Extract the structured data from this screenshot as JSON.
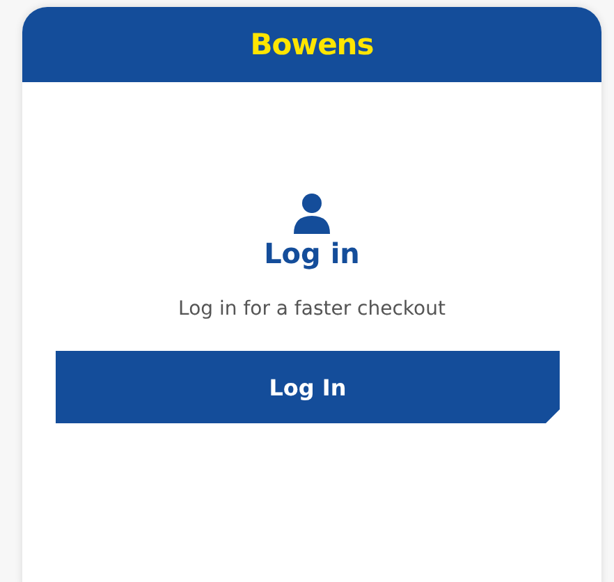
{
  "header": {
    "brand": "Bowens"
  },
  "login": {
    "title": "Log in",
    "subtitle": "Log in for a faster checkout",
    "button": "Log In"
  }
}
